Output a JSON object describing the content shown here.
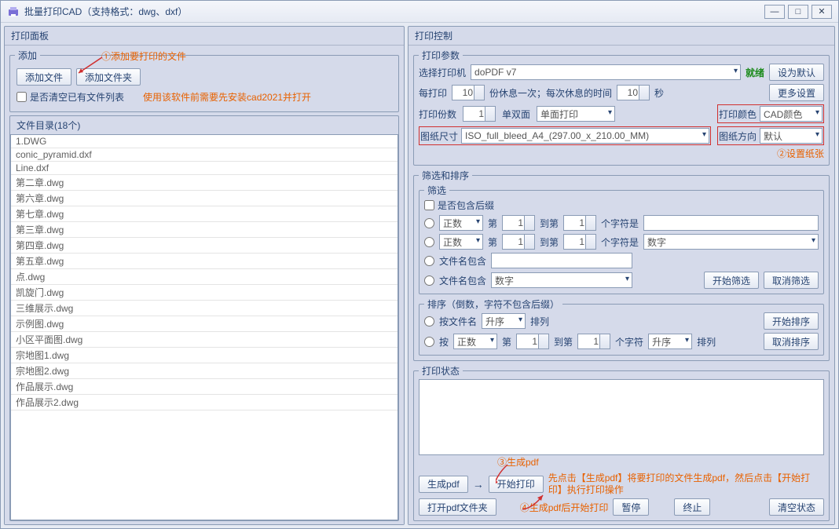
{
  "title": "批量打印CAD（支持格式：dwg、dxf）",
  "left": {
    "panel": "打印面板",
    "add_group": "添加",
    "btn_add_file": "添加文件",
    "btn_add_folder": "添加文件夹",
    "chk_clear": "是否清空已有文件列表",
    "hint_install": "使用该软件前需要先安装cad2021并打开",
    "filelist_title": "文件目录(18个)",
    "files": [
      "1.DWG",
      "conic_pyramid.dxf",
      "Line.dxf",
      "第二章.dwg",
      "第六章.dwg",
      "第七章.dwg",
      "第三章.dwg",
      "第四章.dwg",
      "第五章.dwg",
      "点.dwg",
      "凯旋门.dwg",
      "三维展示.dwg",
      "示例图.dwg",
      "小区平面图.dwg",
      "宗地图1.dwg",
      "宗地图2.dwg",
      "作品展示.dwg",
      "作品展示2.dwg"
    ],
    "ann1": "①添加要打印的文件"
  },
  "right": {
    "ctrl": "打印控制",
    "params": "打印参数",
    "printer_lbl": "选择打印机",
    "printer_val": "doPDF v7",
    "ready": "就绪",
    "btn_default": "设为默认",
    "every_lbl": "每打印",
    "every_val": "10",
    "every_rest": "份休息一次；每次休息的时间",
    "rest_val": "10",
    "sec": "秒",
    "btn_more": "更多设置",
    "copies_lbl": "打印份数",
    "copies_val": "1",
    "duplex_lbl": "单双面",
    "duplex_val": "单面打印",
    "color_lbl": "打印颜色",
    "color_val": "CAD颜色",
    "size_lbl": "图纸尺寸",
    "size_val": "ISO_full_bleed_A4_(297.00_x_210.00_MM)",
    "orient_lbl": "图纸方向",
    "orient_val": "默认",
    "ann2": "②设置纸张",
    "filter_sort": "筛选和排序",
    "filter": "筛选",
    "chk_suffix": "是否包含后缀",
    "int_label": "正数",
    "di": "第",
    "daodi": "到第",
    "gezifu": "个字符是",
    "digit": "数字",
    "v1": "1",
    "fname_contain": "文件名包含",
    "btn_start_filter": "开始筛选",
    "btn_cancel_filter": "取消筛选",
    "sort": "排序（倒数，字符不包含后缀）",
    "by_filename": "按文件名",
    "asc": "升序",
    "pailie": "排列",
    "an": "按",
    "gezifu2": "个字符",
    "btn_start_sort": "开始排序",
    "btn_cancel_sort": "取消排序",
    "status": "打印状态",
    "ann3": "③生成pdf",
    "btn_gen_pdf": "生成pdf",
    "arrow_txt": "→",
    "btn_start_print": "开始打印",
    "hint_pdf": "先点击【生成pdf】将要打印的文件生成pdf，然后点击【开始打印】执行打印操作",
    "ann4": "④生成pdf后开始打印",
    "btn_open_pdf": "打开pdf文件夹",
    "btn_pause": "暂停",
    "btn_stop": "终止",
    "btn_clear": "清空状态"
  }
}
